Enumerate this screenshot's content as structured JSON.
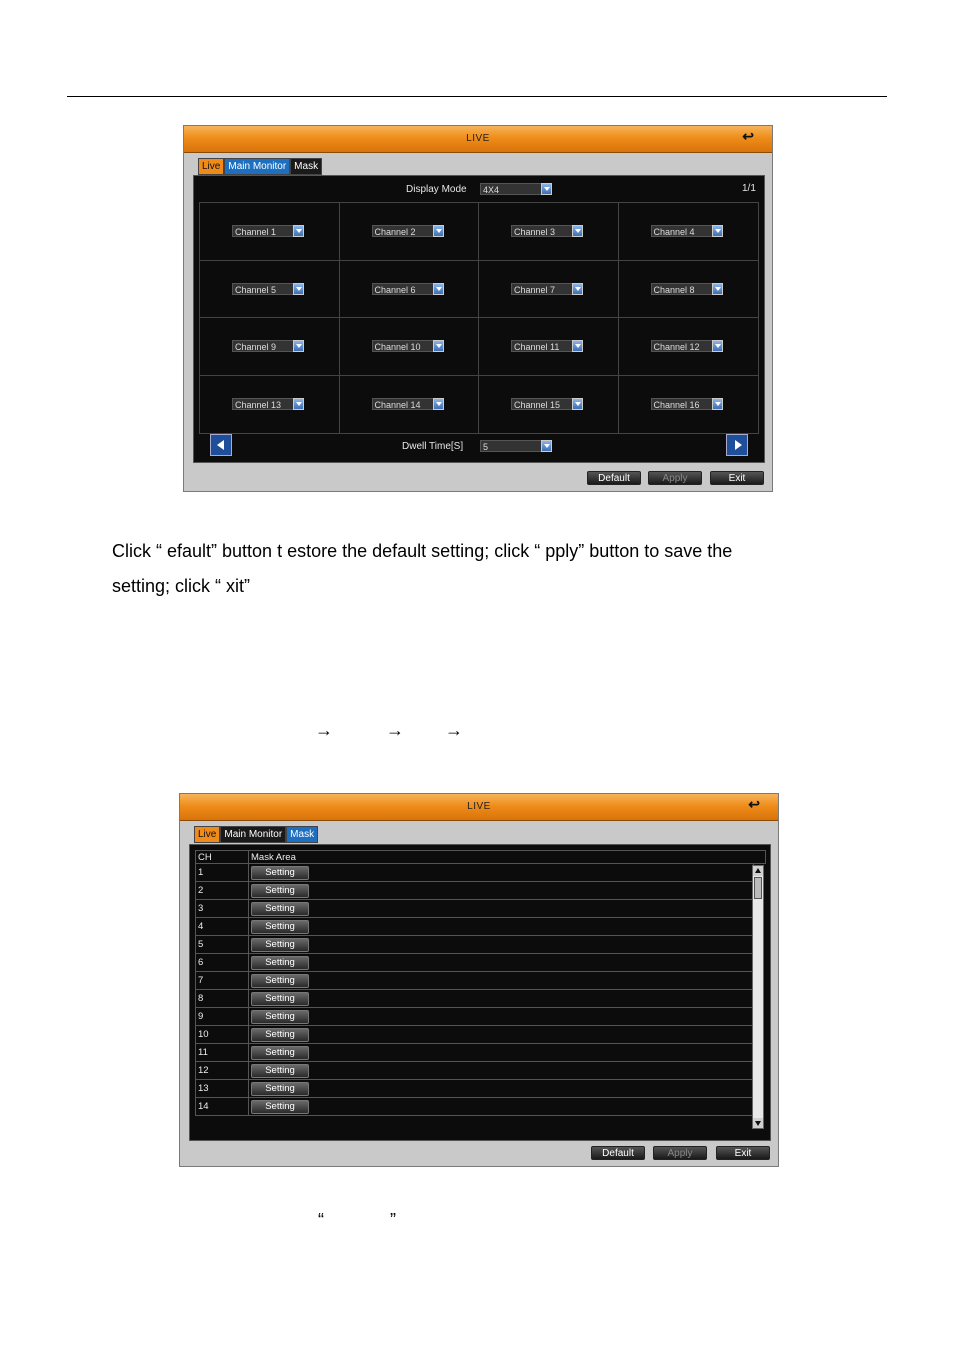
{
  "window1": {
    "title": "LIVE",
    "tabs": [
      "Live",
      "Main Monitor",
      "Mask"
    ],
    "display_mode_label": "Display Mode",
    "display_mode_value": "4X4",
    "page_indicator": "1/1",
    "channels": [
      "Channel 1",
      "Channel 2",
      "Channel 3",
      "Channel 4",
      "Channel 5",
      "Channel 6",
      "Channel 7",
      "Channel 8",
      "Channel 9",
      "Channel 10",
      "Channel 11",
      "Channel 12",
      "Channel 13",
      "Channel 14",
      "Channel 15",
      "Channel 16"
    ],
    "dwell_label": "Dwell Time[S]",
    "dwell_value": "5",
    "buttons": {
      "default": "Default",
      "apply": "Apply",
      "exit": "Exit"
    }
  },
  "paragraph": {
    "line1": "Click “  efault” button t   estore the default setting; click “  pply” button to save the",
    "line2": "setting; click “  xit”"
  },
  "arrows": [
    "→",
    "→",
    "→"
  ],
  "window2": {
    "title": "LIVE",
    "tabs": [
      "Live",
      "Main Monitor",
      "Mask"
    ],
    "col_ch": "CH",
    "col_mask": "Mask Area",
    "rows": [
      "1",
      "2",
      "3",
      "4",
      "5",
      "6",
      "7",
      "8",
      "9",
      "10",
      "11",
      "12",
      "13",
      "14"
    ],
    "setting_label": "Setting",
    "buttons": {
      "default": "Default",
      "apply": "Apply",
      "exit": "Exit"
    }
  },
  "bottom_quotes": {
    "open": "“",
    "close": "”"
  }
}
